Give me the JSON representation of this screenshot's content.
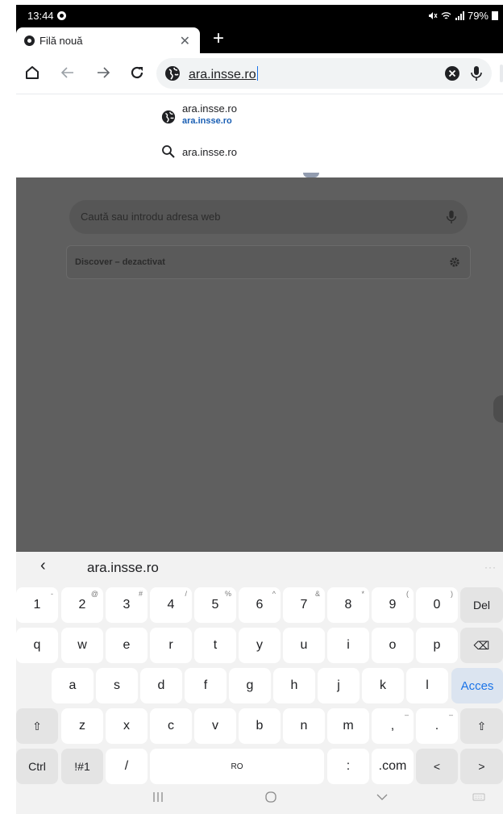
{
  "status": {
    "time": "13:44",
    "battery": "79%"
  },
  "tab": {
    "title": "Filă nouă"
  },
  "toolbar": {
    "address": "ara.insse.ro"
  },
  "suggestions": [
    {
      "title": "ara.insse.ro",
      "url": "ara.insse.ro",
      "icon": "globe-icon"
    },
    {
      "title": "ara.insse.ro",
      "icon": "search-icon"
    }
  ],
  "page": {
    "search_placeholder": "Caută sau introdu adresa web",
    "discover_label": "Discover – dezactivat"
  },
  "keyboard": {
    "suggestion": "ara.insse.ro",
    "more": "···",
    "rows": [
      [
        {
          "k": "1",
          "s": "-"
        },
        {
          "k": "2",
          "s": "@"
        },
        {
          "k": "3",
          "s": "#"
        },
        {
          "k": "4",
          "s": "/"
        },
        {
          "k": "5",
          "s": "%"
        },
        {
          "k": "6",
          "s": "^"
        },
        {
          "k": "7",
          "s": "&"
        },
        {
          "k": "8",
          "s": "*"
        },
        {
          "k": "9",
          "s": "("
        },
        {
          "k": "0",
          "s": ")"
        },
        {
          "k": "Del",
          "s": "",
          "mod": true
        }
      ],
      [
        {
          "k": "q"
        },
        {
          "k": "w"
        },
        {
          "k": "e"
        },
        {
          "k": "r"
        },
        {
          "k": "t"
        },
        {
          "k": "y"
        },
        {
          "k": "u"
        },
        {
          "k": "i"
        },
        {
          "k": "o"
        },
        {
          "k": "p"
        },
        {
          "k": "⌫",
          "mod": true
        }
      ],
      [
        {
          "k": "a"
        },
        {
          "k": "s"
        },
        {
          "k": "d"
        },
        {
          "k": "f"
        },
        {
          "k": "g"
        },
        {
          "k": "h"
        },
        {
          "k": "j"
        },
        {
          "k": "k"
        },
        {
          "k": "l"
        },
        {
          "k": "Acces",
          "accent": true
        }
      ],
      [
        {
          "k": "⇧",
          "mod": true
        },
        {
          "k": "z"
        },
        {
          "k": "x"
        },
        {
          "k": "c"
        },
        {
          "k": "v"
        },
        {
          "k": "b"
        },
        {
          "k": "n"
        },
        {
          "k": "m"
        },
        {
          "k": ",",
          "s": "–"
        },
        {
          "k": ".",
          "s": "–"
        },
        {
          "k": "⇧",
          "mod": true
        }
      ],
      [
        {
          "k": "Ctrl",
          "mod": true
        },
        {
          "k": "!#1",
          "mod": true
        },
        {
          "k": "/"
        },
        {
          "k": "RO",
          "space": true
        },
        {
          "k": ":"
        },
        {
          "k": ".com"
        },
        {
          "k": "<",
          "mod": true
        },
        {
          "k": ">",
          "mod": true
        }
      ]
    ]
  },
  "colors": {
    "accent": "#1a73e8",
    "scrim": "#5f5f5f"
  }
}
